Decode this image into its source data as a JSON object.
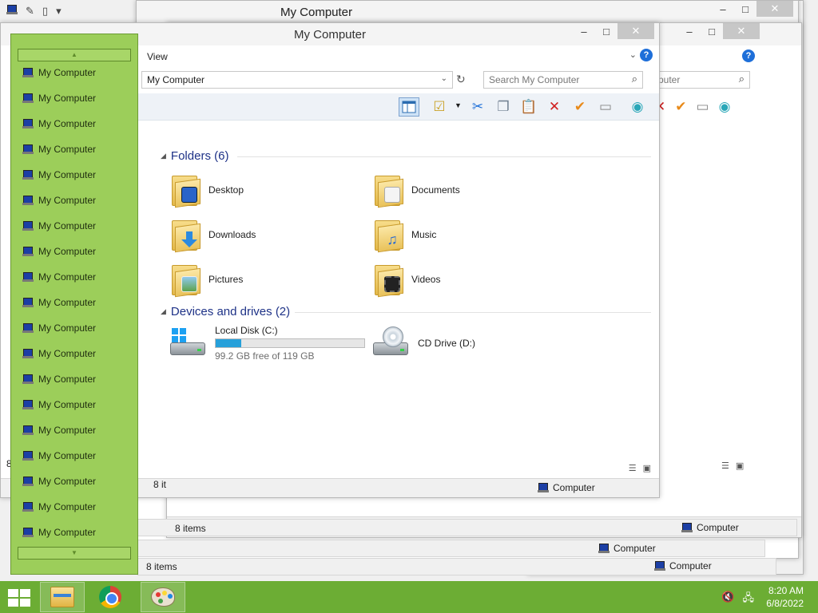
{
  "window_title": "My Computer",
  "menu": {
    "view": "View",
    "help": "?"
  },
  "address": {
    "value": "My Computer",
    "search_placeholder": "Search My Computer"
  },
  "groups": {
    "folders": "Folders (6)",
    "devices": "Devices and drives (2)"
  },
  "folders": [
    {
      "name": "Desktop",
      "icon": "desktop-folder-icon"
    },
    {
      "name": "Documents",
      "icon": "documents-folder-icon"
    },
    {
      "name": "Downloads",
      "icon": "downloads-folder-icon"
    },
    {
      "name": "Music",
      "icon": "music-folder-icon"
    },
    {
      "name": "Pictures",
      "icon": "pictures-folder-icon"
    },
    {
      "name": "Videos",
      "icon": "videos-folder-icon"
    }
  ],
  "drives": [
    {
      "name": "Local Disk (C:)",
      "free_text": "99.2 GB free of 119 GB",
      "used_fraction": 0.17,
      "icon": "hard-disk-icon"
    },
    {
      "name": "CD Drive (D:)",
      "icon": "cd-drive-icon"
    }
  ],
  "status": {
    "items": "8 items",
    "items_partial": "8 it",
    "location": "Computer",
    "location_partial": "puter",
    "location_partial2": "omputer"
  },
  "sidebar": {
    "items": [
      "My Computer",
      "My Computer",
      "My Computer",
      "My Computer",
      "My Computer",
      "My Computer",
      "My Computer",
      "My Computer",
      "My Computer",
      "My Computer",
      "My Computer",
      "My Computer",
      "My Computer",
      "My Computer",
      "My Computer",
      "My Computer",
      "My Computer",
      "My Computer",
      "My Computer"
    ],
    "partial_left": "8"
  },
  "taskbar": {
    "time": "8:20 AM",
    "date": "6/8/2022"
  },
  "colors": {
    "sidebar_green": "#9cce5a",
    "taskbar_green": "#6cad34",
    "group_heading_blue": "#1e3287",
    "drive_bar_blue": "#26a0da"
  }
}
